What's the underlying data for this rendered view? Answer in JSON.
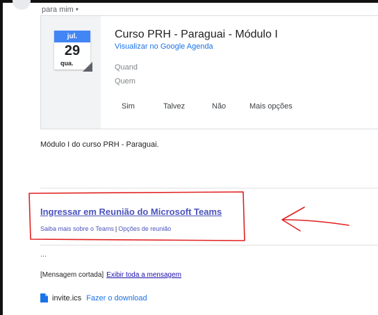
{
  "header": {
    "recipient_label": "para mim",
    "recipient_caret": "▾"
  },
  "invite": {
    "month": "jul.",
    "day": "29",
    "weekday": "qua.",
    "title": "Curso PRH - Paraguai - Módulo I",
    "calendar_link": "Visualizar no Google Agenda",
    "when_label": "Quand",
    "who_label": "Quem",
    "rsvp": {
      "yes": "Sim",
      "maybe": "Talvez",
      "no": "Não",
      "more": "Mais opções"
    }
  },
  "message": {
    "body": "Módulo I do curso PRH - Paraguai.",
    "teams_join": "Ingressar em Reunião do Microsoft Teams",
    "teams_learn_more": "Saiba mais sobre o Teams",
    "teams_separator": "|",
    "teams_meeting_options": "Opções de reunião",
    "ellipsis": "...",
    "clipped_label": "[Mensagem cortada]",
    "view_entire_message": "Exibir toda a mensagem"
  },
  "attachment": {
    "icon": "file-icon",
    "filename": "invite.ics",
    "download": "Fazer o download"
  },
  "colors": {
    "accent_blue": "#4285f4",
    "link_blue": "#1a73e8",
    "teams_purple": "#4b53bc",
    "annotation_red": "#e02020"
  }
}
